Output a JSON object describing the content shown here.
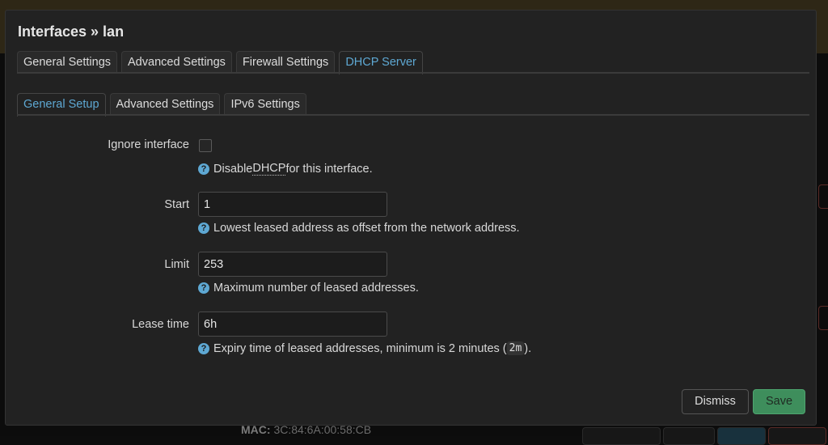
{
  "background": {
    "mac_label": "MAC:",
    "mac_value": "3C:84:6A:00:58:CB"
  },
  "modal": {
    "title": "Interfaces » lan",
    "tabs": [
      {
        "label": "General Settings",
        "active": false
      },
      {
        "label": "Advanced Settings",
        "active": false
      },
      {
        "label": "Firewall Settings",
        "active": false
      },
      {
        "label": "DHCP Server",
        "active": true
      }
    ],
    "subtabs": [
      {
        "label": "General Setup",
        "active": true
      },
      {
        "label": "Advanced Settings",
        "active": false
      },
      {
        "label": "IPv6 Settings",
        "active": false
      }
    ],
    "fields": {
      "ignore": {
        "label": "Ignore interface",
        "checked": false,
        "help_pre": "Disable ",
        "help_abbr": "DHCP",
        "help_post": " for this interface."
      },
      "start": {
        "label": "Start",
        "value": "1",
        "help": "Lowest leased address as offset from the network address."
      },
      "limit": {
        "label": "Limit",
        "value": "253",
        "help": "Maximum number of leased addresses."
      },
      "leasetime": {
        "label": "Lease time",
        "value": "6h",
        "help_pre": "Expiry time of leased addresses, minimum is 2 minutes (",
        "help_code": "2m",
        "help_post": ")."
      }
    },
    "help_icon": "?",
    "buttons": {
      "dismiss": "Dismiss",
      "save": "Save"
    }
  }
}
